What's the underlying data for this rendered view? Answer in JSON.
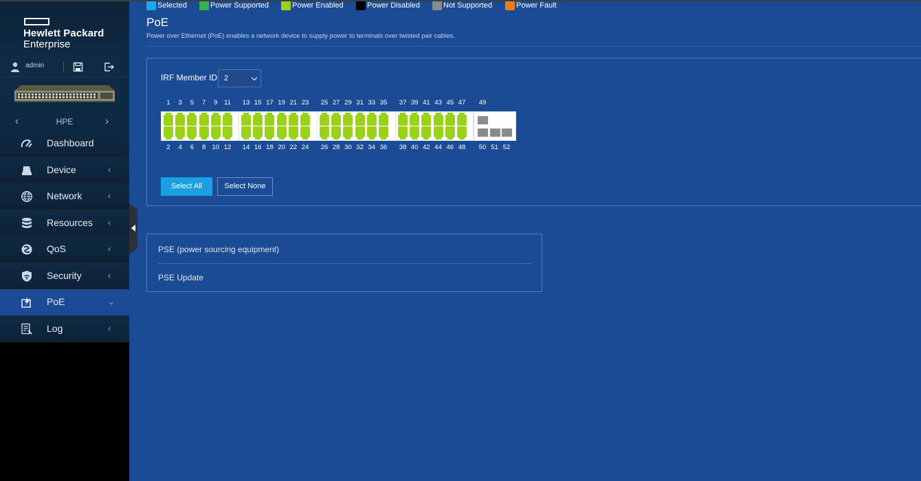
{
  "brand": {
    "line1": "Hewlett Packard",
    "line2": "Enterprise"
  },
  "user": {
    "name": "admin"
  },
  "device": {
    "name": "HPE"
  },
  "nav": {
    "items": [
      {
        "label": "Dashboard",
        "icon": "gauge-icon"
      },
      {
        "label": "Device",
        "icon": "device-icon"
      },
      {
        "label": "Network",
        "icon": "globe-icon"
      },
      {
        "label": "Resources",
        "icon": "database-icon"
      },
      {
        "label": "QoS",
        "icon": "qos-icon"
      },
      {
        "label": "Security",
        "icon": "shield-icon"
      },
      {
        "label": "PoE",
        "icon": "poe-icon"
      },
      {
        "label": "Log",
        "icon": "log-icon"
      }
    ],
    "active": "PoE"
  },
  "page": {
    "title": "PoE",
    "description": "Power over Ethernet (PoE) enables a network device to supply power to terminals over twisted pair cables."
  },
  "irf": {
    "label": "IRF Member ID",
    "value": "2"
  },
  "ports": {
    "groups": [
      {
        "top": [
          "1",
          "3",
          "5",
          "7",
          "9",
          "11"
        ],
        "bottom": [
          "2",
          "4",
          "6",
          "8",
          "10",
          "12"
        ],
        "state": "Power Enabled"
      },
      {
        "top": [
          "13",
          "15",
          "17",
          "19",
          "21",
          "23"
        ],
        "bottom": [
          "14",
          "16",
          "18",
          "20",
          "22",
          "24"
        ],
        "state": "Power Enabled"
      },
      {
        "top": [
          "25",
          "27",
          "29",
          "31",
          "33",
          "35"
        ],
        "bottom": [
          "26",
          "28",
          "30",
          "32",
          "34",
          "36"
        ],
        "state": "Power Enabled"
      },
      {
        "top": [
          "37",
          "39",
          "41",
          "43",
          "45",
          "47"
        ],
        "bottom": [
          "38",
          "40",
          "42",
          "44",
          "46",
          "48"
        ],
        "state": "Power Enabled"
      },
      {
        "top": [
          "49"
        ],
        "bottom": [
          "50",
          "51",
          "52"
        ],
        "state": "Not Supported"
      }
    ]
  },
  "buttons": {
    "select_all": "Select All",
    "select_none": "Select None"
  },
  "legend": [
    {
      "label": "Selected",
      "color": "#1ea7ea"
    },
    {
      "label": "Power Supported",
      "color": "#2fb34a"
    },
    {
      "label": "Power Enabled",
      "color": "#9ad21a"
    },
    {
      "label": "Power Disabled",
      "color": "#000000"
    },
    {
      "label": "Not Supported",
      "color": "#8b8b8b"
    },
    {
      "label": "Power Fault",
      "color": "#f07c14"
    }
  ],
  "pse": {
    "item1": "PSE (power sourcing equipment)",
    "item2": "PSE Update"
  }
}
